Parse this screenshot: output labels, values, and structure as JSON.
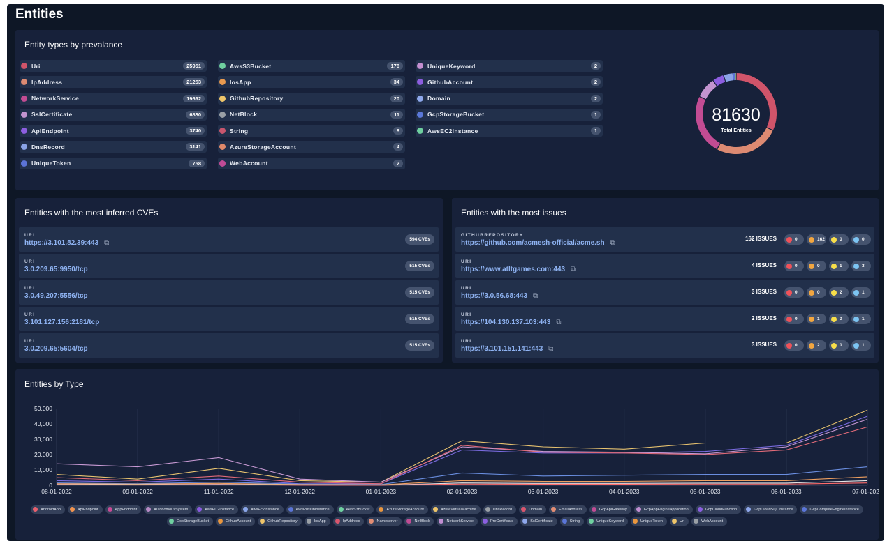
{
  "page": {
    "title": "Entities"
  },
  "prevalence": {
    "title": "Entity types by prevalance",
    "total": "81630",
    "total_label": "Total Entities",
    "columns": [
      [
        {
          "name": "Uri",
          "count": "25951",
          "color": "#d0546a"
        },
        {
          "name": "IpAddress",
          "count": "21253",
          "color": "#dc8a72"
        },
        {
          "name": "NetworkService",
          "count": "19692",
          "color": "#c24c93"
        },
        {
          "name": "SslCertificate",
          "count": "6830",
          "color": "#c394cf"
        },
        {
          "name": "ApiEndpoint",
          "count": "3740",
          "color": "#8d5ee0"
        },
        {
          "name": "DnsRecord",
          "count": "3141",
          "color": "#8aa3e6"
        },
        {
          "name": "UniqueToken",
          "count": "758",
          "color": "#5b73d6"
        }
      ],
      [
        {
          "name": "AwsS3Bucket",
          "count": "178",
          "color": "#6fd0a0"
        },
        {
          "name": "IosApp",
          "count": "34",
          "color": "#e99a4f"
        },
        {
          "name": "GithubRepository",
          "count": "20",
          "color": "#eec56a"
        },
        {
          "name": "NetBlock",
          "count": "11",
          "color": "#9aa0a6"
        },
        {
          "name": "String",
          "count": "8",
          "color": "#c8566e"
        },
        {
          "name": "AzureStorageAccount",
          "count": "4",
          "color": "#e0896a"
        },
        {
          "name": "WebAccount",
          "count": "2",
          "color": "#c14b96"
        }
      ],
      [
        {
          "name": "UniqueKeyword",
          "count": "2",
          "color": "#c48fd0"
        },
        {
          "name": "GithubAccount",
          "count": "2",
          "color": "#8d5ee0"
        },
        {
          "name": "Domain",
          "count": "2",
          "color": "#8ea8ec"
        },
        {
          "name": "GcpStorageBucket",
          "count": "1",
          "color": "#5b78d8"
        },
        {
          "name": "AwsEC2Instance",
          "count": "1",
          "color": "#6fd0a0"
        }
      ]
    ]
  },
  "cves": {
    "title": "Entities with the most inferred CVEs",
    "rows": [
      {
        "type": "URI",
        "link": "https://3.101.82.39:443",
        "ext": true,
        "cves": "594 CVEs"
      },
      {
        "type": "URI",
        "link": "3.0.209.65:9950/tcp",
        "ext": false,
        "cves": "515 CVEs"
      },
      {
        "type": "URI",
        "link": "3.0.49.207:5556/tcp",
        "ext": false,
        "cves": "515 CVEs"
      },
      {
        "type": "URI",
        "link": "3.101.127.156:2181/tcp",
        "ext": false,
        "cves": "515 CVEs"
      },
      {
        "type": "URI",
        "link": "3.0.209.65:5604/tcp",
        "ext": false,
        "cves": "515 CVEs"
      }
    ]
  },
  "issues": {
    "title": "Entities with the most issues",
    "severity_colors": [
      "#f0525a",
      "#f2a640",
      "#f7de4a",
      "#7cc4f2"
    ],
    "rows": [
      {
        "type": "GITHUBREPOSITORY",
        "link": "https://github.com/acmesh-official/acme.sh",
        "count": "162 ISSUES",
        "sev": [
          "0",
          "162",
          "0",
          "0"
        ]
      },
      {
        "type": "URI",
        "link": "https://www.atltgames.com:443",
        "count": "4 ISSUES",
        "sev": [
          "0",
          "0",
          "1",
          "3"
        ]
      },
      {
        "type": "URI",
        "link": "https://3.0.56.68:443",
        "count": "3 ISSUES",
        "sev": [
          "0",
          "0",
          "2",
          "1"
        ]
      },
      {
        "type": "URI",
        "link": "https://104.130.137.103:443",
        "count": "2 ISSUES",
        "sev": [
          "0",
          "1",
          "0",
          "1"
        ]
      },
      {
        "type": "URI",
        "link": "https://3.101.151.141:443",
        "count": "3 ISSUES",
        "sev": [
          "0",
          "2",
          "0",
          "1"
        ]
      }
    ]
  },
  "chart_data": {
    "type": "line",
    "title": "Entities by Type",
    "categories": [
      "08-01-2022",
      "09-01-2022",
      "11-01-2022",
      "12-01-2022",
      "01-01-2023",
      "02-01-2023",
      "03-01-2023",
      "04-01-2023",
      "05-01-2023",
      "06-01-2023",
      "07-01-2023"
    ],
    "ylim": [
      0,
      50000
    ],
    "yticks": [
      "0",
      "10,000",
      "20,000",
      "30,000",
      "40,000",
      "50,000"
    ],
    "grid": true,
    "series": [
      {
        "name": "AzureVirtualMachine",
        "color": "#e8c36f",
        "values": [
          7000,
          4000,
          11000,
          3000,
          2000,
          29000,
          25000,
          23500,
          27500,
          27500,
          49000
        ]
      },
      {
        "name": "AwsEC2Instance",
        "color": "#7a6be0",
        "values": [
          3000,
          2000,
          4000,
          1000,
          1000,
          23000,
          21000,
          21000,
          22000,
          26000,
          45000
        ]
      },
      {
        "name": "AppEndpoint",
        "color": "#c89ad4",
        "values": [
          14000,
          12000,
          18000,
          4000,
          2000,
          25000,
          22000,
          21500,
          20500,
          25000,
          43000
        ]
      },
      {
        "name": "Domain",
        "color": "#e06a78",
        "values": [
          5000,
          3000,
          6000,
          2000,
          1000,
          26000,
          21500,
          21000,
          20000,
          23000,
          38000
        ]
      },
      {
        "name": "GcpCloudSQLInstance",
        "color": "#6a8ee0",
        "values": [
          1500,
          1000,
          2000,
          800,
          500,
          8000,
          6000,
          6500,
          7000,
          7000,
          12000
        ]
      },
      {
        "name": "AzureStorageAccount",
        "color": "#f0a060",
        "values": [
          1000,
          800,
          1200,
          500,
          300,
          3000,
          2500,
          2500,
          3000,
          3000,
          5500
        ]
      },
      {
        "name": "WebAccount",
        "color": "#e6e6e6",
        "values": [
          500,
          400,
          600,
          200,
          100,
          1500,
          1200,
          1200,
          1400,
          1400,
          3000
        ]
      },
      {
        "name": "ApiEndpoint",
        "color": "#ff6b6b",
        "values": [
          300,
          200,
          400,
          100,
          100,
          800,
          700,
          700,
          800,
          800,
          1500
        ]
      }
    ],
    "legend": [
      {
        "name": "AndroidApp",
        "color": "#e8606e"
      },
      {
        "name": "ApiEndpoint",
        "color": "#f0934f"
      },
      {
        "name": "AppEndpoint",
        "color": "#c84b96"
      },
      {
        "name": "AutonomousSystem",
        "color": "#b78ac6"
      },
      {
        "name": "AwsEC2Instance",
        "color": "#8a5ae0"
      },
      {
        "name": "AwsEc2Instance",
        "color": "#8aa6ea"
      },
      {
        "name": "AwsRdsDbInstance",
        "color": "#5a74d6"
      },
      {
        "name": "AwsS3Bucket",
        "color": "#6ed1a0"
      },
      {
        "name": "AzureStorageAccount",
        "color": "#e9963e"
      },
      {
        "name": "AzureVirtualMachine",
        "color": "#eec56a"
      },
      {
        "name": "DnsRecord",
        "color": "#9aa0a6"
      },
      {
        "name": "Domain",
        "color": "#d8566e"
      },
      {
        "name": "EmailAddress",
        "color": "#e28d74"
      },
      {
        "name": "GcpApiGateway",
        "color": "#c04c94"
      },
      {
        "name": "GcpAppEngineApplication",
        "color": "#c18ed2"
      },
      {
        "name": "GcpCloudFunction",
        "color": "#8b5fe0"
      },
      {
        "name": "GcpCloudSQLInstance",
        "color": "#8ea7ec"
      },
      {
        "name": "GcpComputeEngineInstance",
        "color": "#5b76d8"
      },
      {
        "name": "GcpStorageBucket",
        "color": "#6fd0a0"
      },
      {
        "name": "GithubAccount",
        "color": "#e9963e"
      },
      {
        "name": "GithubRepository",
        "color": "#eec56a"
      },
      {
        "name": "IosApp",
        "color": "#9aa0a6"
      },
      {
        "name": "IpAddress",
        "color": "#d8566e"
      },
      {
        "name": "Nameserver",
        "color": "#e28d74"
      },
      {
        "name": "NetBlock",
        "color": "#c04c94"
      },
      {
        "name": "NetworkService",
        "color": "#c18ed2"
      },
      {
        "name": "PreCertificate",
        "color": "#8b5fe0"
      },
      {
        "name": "SslCertificate",
        "color": "#8ea7ec"
      },
      {
        "name": "String",
        "color": "#5b76d8"
      },
      {
        "name": "UniqueKeyword",
        "color": "#6fd0a0"
      },
      {
        "name": "UniqueToken",
        "color": "#e9963e"
      },
      {
        "name": "Uri",
        "color": "#eec56a"
      },
      {
        "name": "WebAccount",
        "color": "#9aa0a6"
      }
    ]
  }
}
